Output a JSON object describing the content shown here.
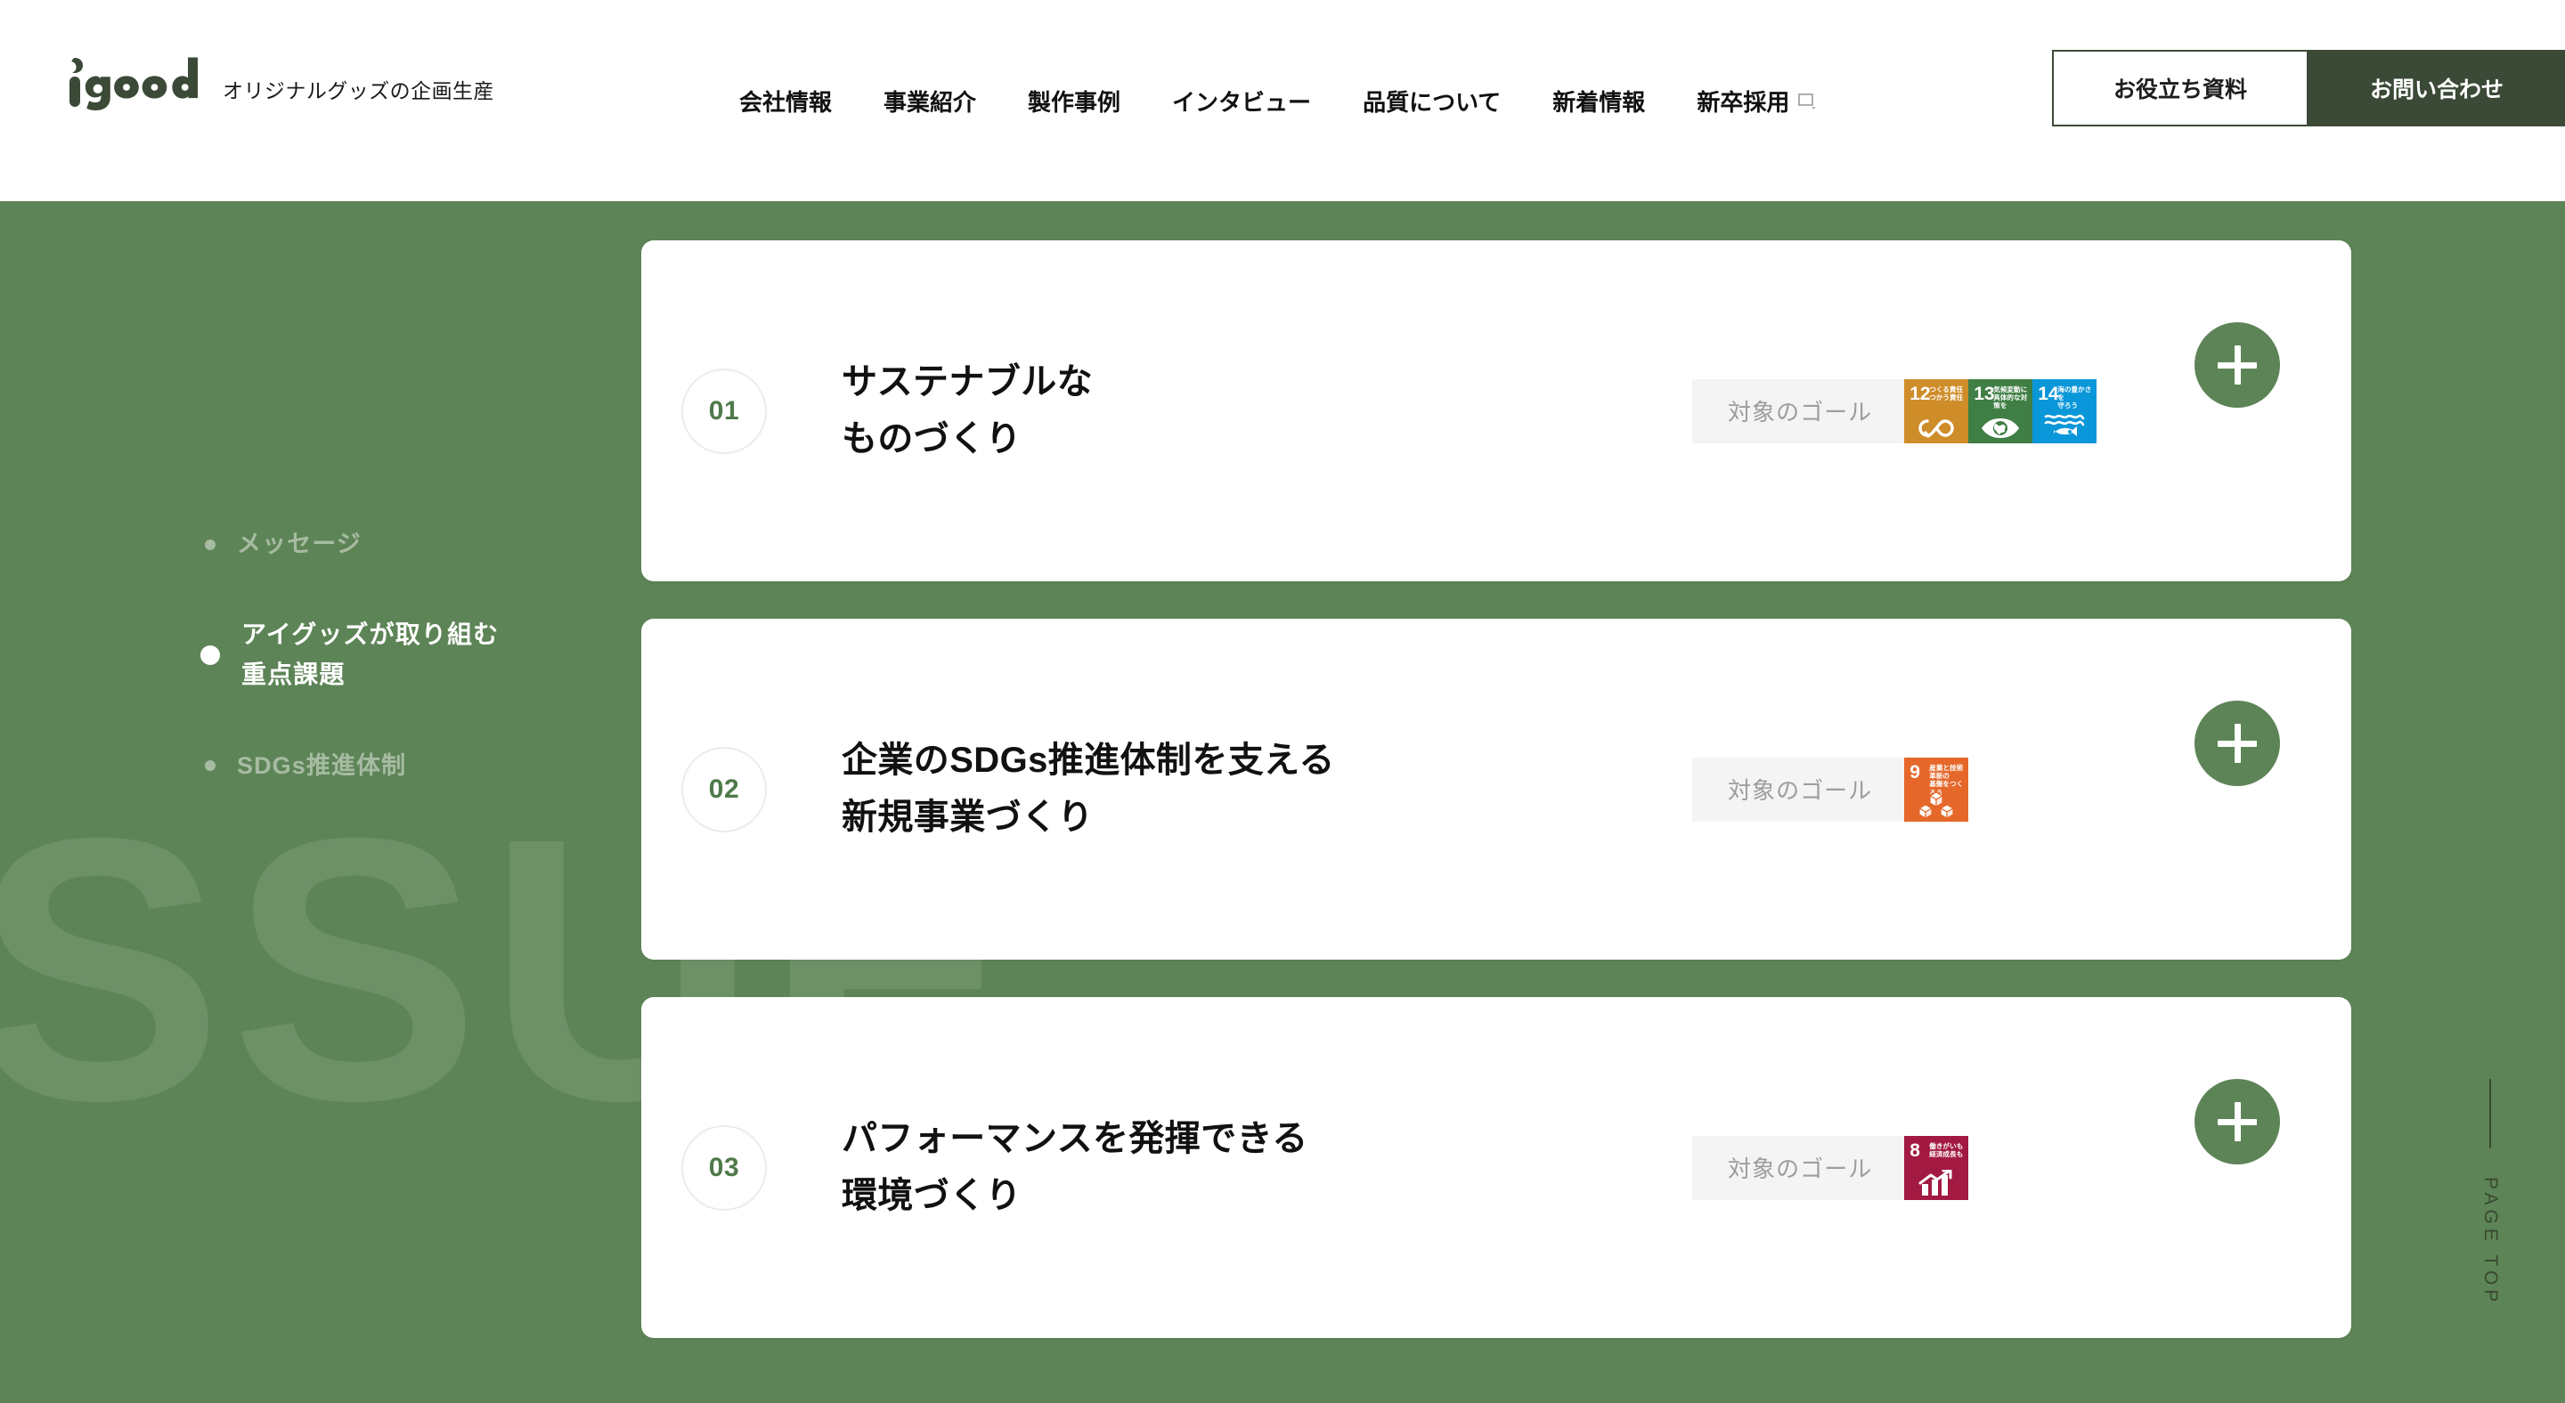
{
  "header": {
    "logo_text": "igoods",
    "tagline": "オリジナルグッズの企画生産",
    "nav": [
      {
        "label": "会社情報",
        "external": false
      },
      {
        "label": "事業紹介",
        "external": false
      },
      {
        "label": "製作事例",
        "external": false
      },
      {
        "label": "インタビュー",
        "external": false
      },
      {
        "label": "品質について",
        "external": false
      },
      {
        "label": "新着情報",
        "external": false
      },
      {
        "label": "新卒採用",
        "external": true
      }
    ],
    "btn_documents": "お役立ち資料",
    "btn_contact": "お問い合わせ"
  },
  "watermark": "SSUE",
  "sidebar": {
    "items": [
      {
        "label": "メッセージ",
        "active": false
      },
      {
        "label": "アイグッズが取り組む\n重点課題",
        "active": true
      },
      {
        "label": "SDGs推進体制",
        "active": false
      }
    ]
  },
  "cards": [
    {
      "number": "01",
      "title": "サステナブルな\nものづくり",
      "goal_label": "対象のゴール",
      "goals": [
        {
          "num": "12",
          "text": "つくる責任\nつかう責任",
          "color": "#cf8d2a",
          "glyph": "infinity"
        },
        {
          "num": "13",
          "text": "気候変動に\n具体的な対策を",
          "color": "#3f7e44",
          "glyph": "eye-earth"
        },
        {
          "num": "14",
          "text": "海の豊かさを\n守ろう",
          "color": "#0a97d9",
          "glyph": "fish"
        }
      ],
      "expand_label": "+"
    },
    {
      "number": "02",
      "title": "企業のSDGs推進体制を支える\n新規事業づくり",
      "goal_label": "対象のゴール",
      "goals": [
        {
          "num": "9",
          "text": "産業と技術革新の\n基盤をつくろう",
          "color": "#e5682a",
          "glyph": "cubes"
        }
      ],
      "expand_label": "+"
    },
    {
      "number": "03",
      "title": "パフォーマンスを発揮できる\n環境づくり",
      "goal_label": "対象のゴール",
      "goals": [
        {
          "num": "8",
          "text": "働きがいも\n経済成長も",
          "color": "#a21942",
          "glyph": "growth"
        }
      ],
      "expand_label": "+"
    }
  ],
  "page_top": {
    "label": "PAGE TOP"
  },
  "colors": {
    "background_green": "#5d8456",
    "dark_green": "#3b4a37",
    "accent_green": "#4e7a4a",
    "card_white": "#ffffff",
    "goal_box_gray": "#f4f4f4"
  }
}
